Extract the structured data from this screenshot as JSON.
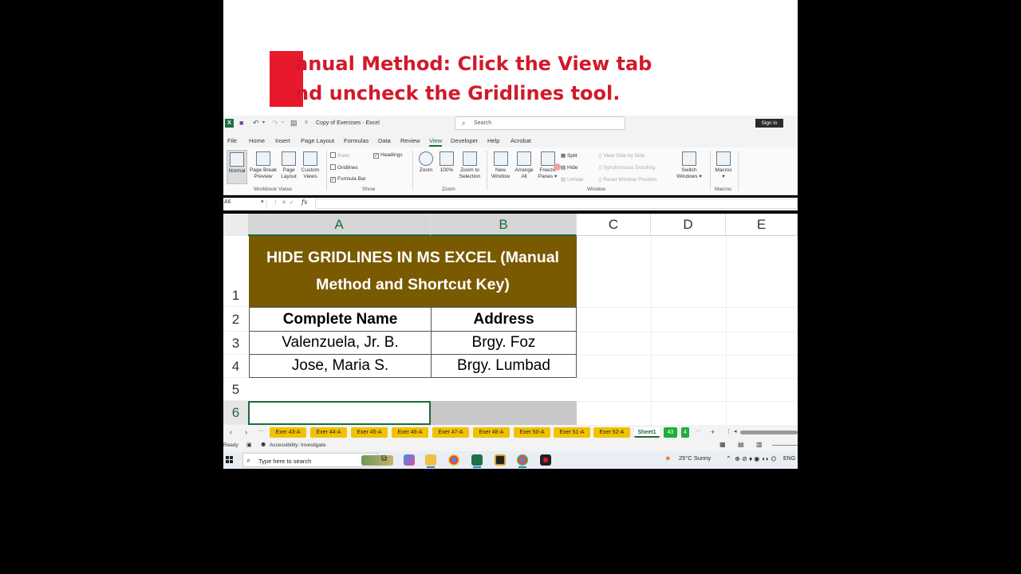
{
  "caption": {
    "line1": "anual Method: Click the View tab",
    "line2": "nd uncheck the Gridlines tool."
  },
  "titlebar": {
    "doc_title": "Copy of Exercises - Excel",
    "search_placeholder": "Search",
    "signin": "Sign in"
  },
  "menu": [
    "File",
    "Home",
    "Insert",
    "Page Layout",
    "Formulas",
    "Data",
    "Review",
    "View",
    "Developer",
    "Help",
    "Acrobat"
  ],
  "ribbon": {
    "workbook_views": {
      "label": "Workbook Views",
      "normal": "Normal",
      "page_break_1": "Page Break",
      "page_break_2": "Preview",
      "page_layout_1": "Page",
      "page_layout_2": "Layout",
      "custom_1": "Custom",
      "custom_2": "Views"
    },
    "show": {
      "label": "Show",
      "ruler": "Ruler",
      "gridlines": "Gridlines",
      "formula_bar": "Formula Bar",
      "headings": "Headings"
    },
    "zoom": {
      "label": "Zoom",
      "zoom": "Zoom",
      "hundred": "100%",
      "sel_1": "Zoom to",
      "sel_2": "Selection"
    },
    "window": {
      "label": "Window",
      "new_1": "New",
      "new_2": "Window",
      "arrange_1": "Arrange",
      "arrange_2": "All",
      "freeze_1": "Freeze",
      "freeze_2": "Panes",
      "split": "Split",
      "hide": "Hide",
      "unhide": "Unhide",
      "side": "View Side by Side",
      "sync": "Synchronous Scrolling",
      "reset": "Reset Window Position",
      "switch_1": "Switch",
      "switch_2": "Windows"
    },
    "macros": {
      "label": "Macros",
      "btn": "Macros"
    }
  },
  "formula_bar": {
    "name_box": "A6",
    "fx": "fx",
    "value": ""
  },
  "columns": [
    "A",
    "B",
    "C",
    "D",
    "E"
  ],
  "rows": [
    "1",
    "2",
    "3",
    "4",
    "5",
    "6"
  ],
  "table": {
    "title_line1": "HIDE GRIDLINES IN MS EXCEL (Manual",
    "title_line2": "Method and Shortcut Key)",
    "headers": [
      "Complete Name",
      "Address"
    ],
    "rows": [
      [
        "Valenzuela, Jr. B.",
        "Brgy. Foz"
      ],
      [
        "Jose, Maria S.",
        "Brgy. Lumbad"
      ]
    ],
    "title_bg": "#7a5a00"
  },
  "sheet_tabs": [
    "Exer 43-A",
    "Exer 44-A",
    "Exer 45-A",
    "Exer 46-A",
    "Exer 47-A",
    "Exer 48-A",
    "Exer 50-A",
    "Exer 51-A",
    "Exer 52-A",
    "Sheet1",
    "43",
    "4"
  ],
  "status": {
    "ready": "Ready",
    "accessibility": "Accessibility: Investigate"
  },
  "taskbar": {
    "search": "Type here to search",
    "weather": "25°C  Sunny",
    "lang": "ENG"
  },
  "colors": {
    "excel_green": "#1d6b3c",
    "tab_yellow": "#f2c200",
    "caption_red": "#d11a2a"
  }
}
